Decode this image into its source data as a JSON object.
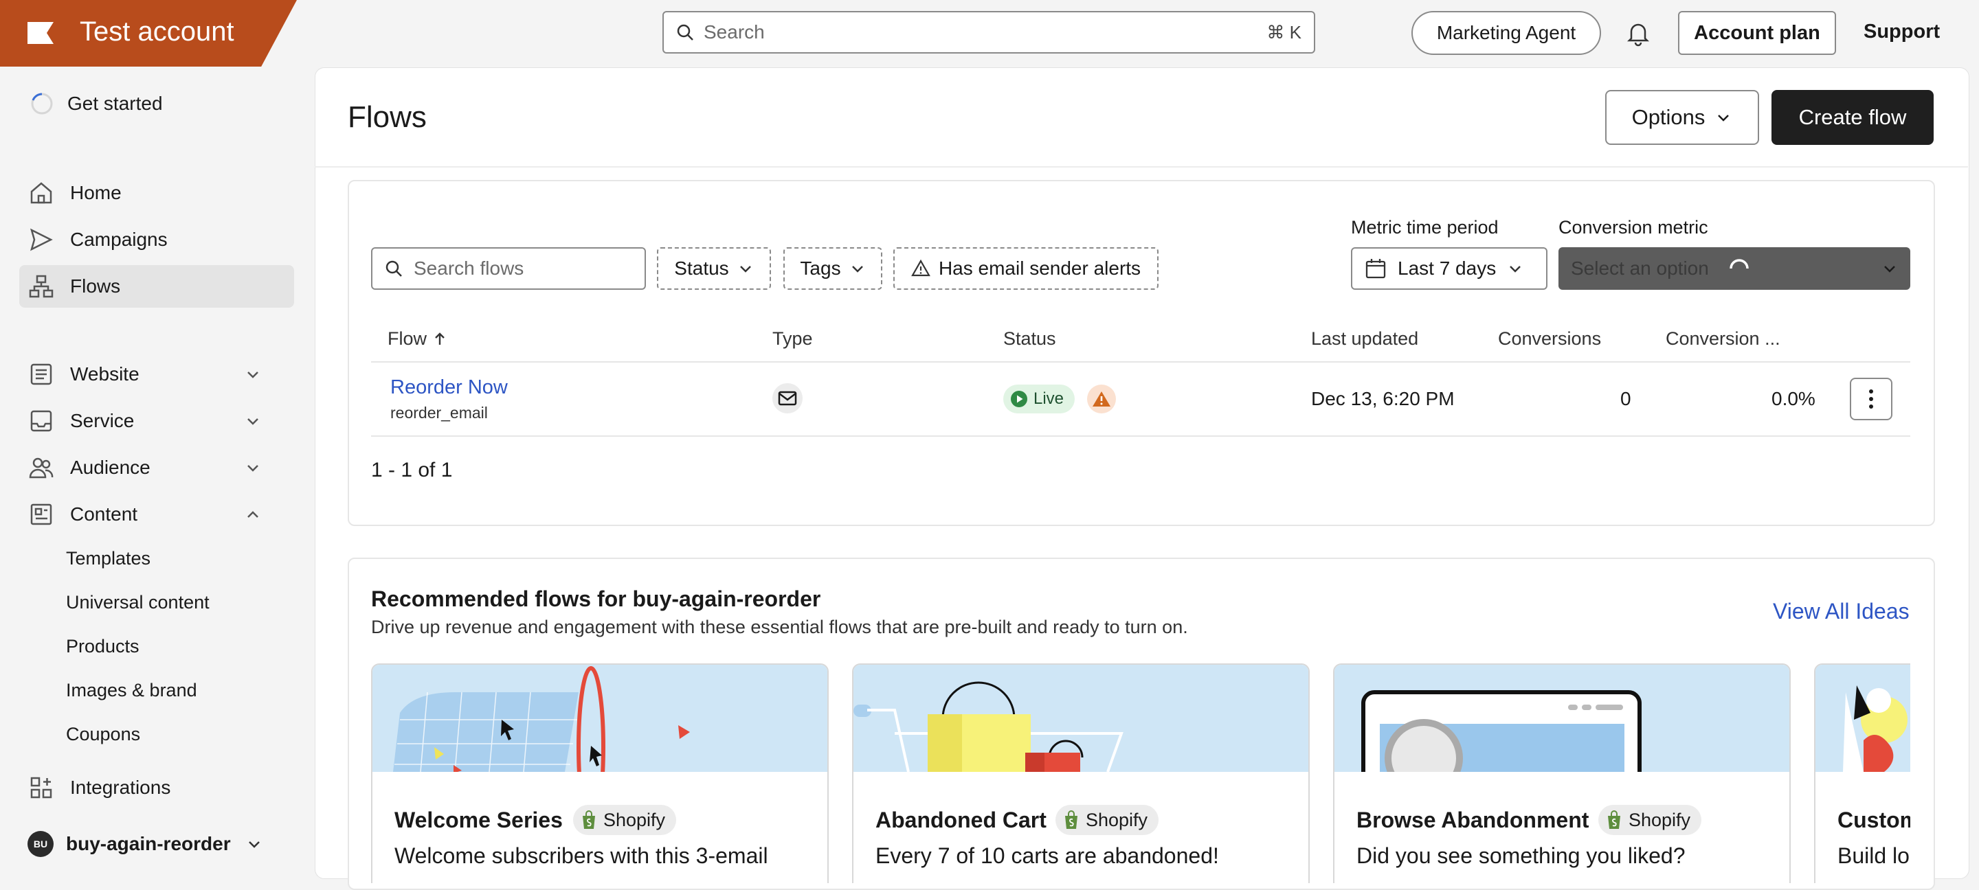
{
  "brand": {
    "title": "Test account"
  },
  "topbar": {
    "search_placeholder": "Search",
    "search_shortcut": "⌘ K",
    "marketing_agent": "Marketing Agent",
    "account_plan": "Account plan",
    "support": "Support"
  },
  "sidebar": {
    "get_started": "Get started",
    "items": [
      {
        "label": "Home",
        "icon": "home-icon"
      },
      {
        "label": "Campaigns",
        "icon": "send-icon"
      },
      {
        "label": "Flows",
        "icon": "flows-icon",
        "active": true
      },
      {
        "label": "Website",
        "icon": "website-icon"
      },
      {
        "label": "Service",
        "icon": "inbox-icon"
      },
      {
        "label": "Audience",
        "icon": "people-icon"
      },
      {
        "label": "Content",
        "icon": "content-icon"
      }
    ],
    "content_sub": [
      "Templates",
      "Universal content",
      "Products",
      "Images & brand",
      "Coupons"
    ],
    "integrations": "Integrations",
    "workspace": {
      "initials": "BU",
      "name": "buy-again-reorder"
    }
  },
  "header": {
    "title": "Flows",
    "options_label": "Options",
    "create_label": "Create flow"
  },
  "filters": {
    "search_placeholder": "Search flows",
    "status": "Status",
    "tags": "Tags",
    "alerts": "Has email sender alerts",
    "metric_period_label": "Metric time period",
    "metric_period_value": "Last 7 days",
    "conversion_label": "Conversion metric",
    "conversion_placeholder": "Select an option"
  },
  "table": {
    "columns": [
      "Flow",
      "Type",
      "Status",
      "Last updated",
      "Conversions",
      "Conversion ..."
    ],
    "rows": [
      {
        "name": "Reorder Now",
        "id": "reorder_email",
        "type": "email",
        "status": "Live",
        "last_updated": "Dec 13, 6:20 PM",
        "conversions": "0",
        "conversion_rate": "0.0%"
      }
    ],
    "pagination": "1 - 1 of 1"
  },
  "recommended": {
    "title": "Recommended flows for buy-again-reorder",
    "subtitle": "Drive up revenue and engagement with these essential flows that are pre-built and ready to turn on.",
    "view_all": "View All Ideas",
    "cards": [
      {
        "name": "Welcome Series",
        "badge": "Shopify",
        "desc": "Welcome subscribers with this 3-email"
      },
      {
        "name": "Abandoned Cart",
        "badge": "Shopify",
        "desc": "Every 7 of 10 carts are abandoned!"
      },
      {
        "name": "Browse Abandonment",
        "badge": "Shopify",
        "desc": "Did you see something you liked?"
      },
      {
        "name": "Custom",
        "badge": "",
        "desc": "Build lo"
      }
    ]
  },
  "colors": {
    "brand": "#b84c1c",
    "link": "#2d55c4",
    "primary_button": "#1f1f1f",
    "live_badge_bg": "#e1f4e4",
    "warning": "#d2691e"
  }
}
